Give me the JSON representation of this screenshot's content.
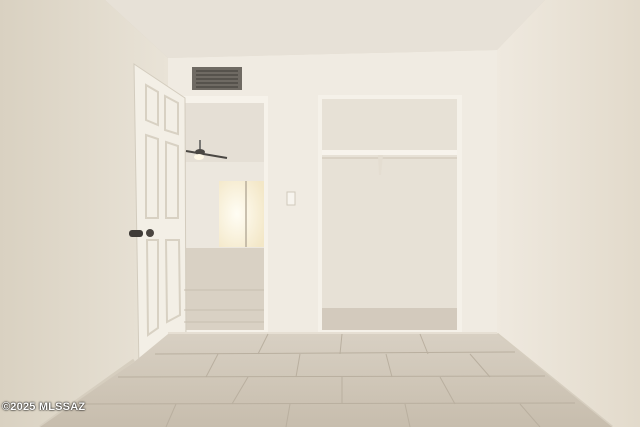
{
  "photo": {
    "watermark": "©2025 MLSSAZ"
  },
  "colors": {
    "ceiling": "#e8e2d9",
    "left_wall": "#e2dbcd",
    "right_wall": "#ece6db",
    "back_wall": "#f1ece3",
    "closet_interior": "#e9e3d8",
    "floor": "#cdc4b6",
    "door": "#f3efe7",
    "window_light": "#fff9e8"
  }
}
